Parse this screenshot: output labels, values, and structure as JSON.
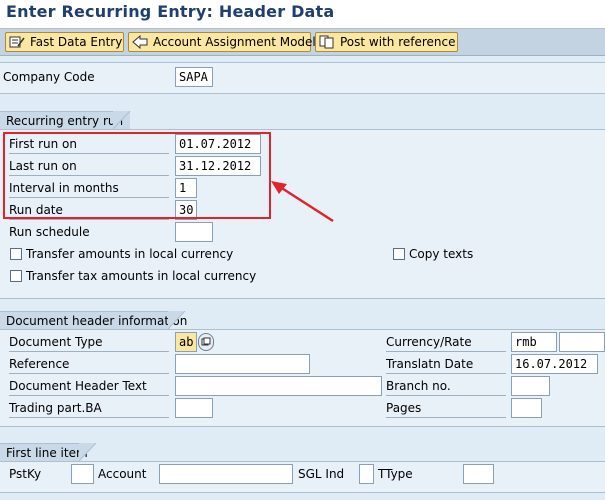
{
  "title": "Enter Recurring Entry: Header Data",
  "toolbar": {
    "fast_data_entry": "Fast Data Entry",
    "account_assignment_model": "Account Assignment Model",
    "post_with_reference": "Post with reference"
  },
  "company": {
    "label": "Company Code",
    "value": "SAPA"
  },
  "recurring": {
    "section_title": "Recurring entry run",
    "first_run_label": "First run on",
    "first_run_value": "01.07.2012",
    "last_run_label": "Last run on",
    "last_run_value": "31.12.2012",
    "interval_label": "Interval in months",
    "interval_value": "1",
    "run_date_label": "Run date",
    "run_date_value": "30",
    "run_schedule_label": "Run schedule",
    "run_schedule_value": "",
    "transfer_local_label": "Transfer amounts in local currency",
    "transfer_tax_label": "Transfer tax amounts in local currency",
    "copy_texts_label": "Copy texts"
  },
  "doc_header": {
    "section_title": "Document header information",
    "doc_type_label": "Document Type",
    "doc_type_value": "ab",
    "reference_label": "Reference",
    "reference_value": "",
    "header_text_label": "Document Header Text",
    "header_text_value": "",
    "trading_label": "Trading part.BA",
    "trading_value": "",
    "currency_label": "Currency/Rate",
    "currency_value": "rmb",
    "rate_value": "",
    "translation_label": "Translatn Date",
    "translation_value": "16.07.2012",
    "branch_label": "Branch no.",
    "branch_value": "",
    "pages_label": "Pages",
    "pages_value": ""
  },
  "first_line": {
    "section_title": "First line item",
    "pstky_label": "PstKy",
    "pstky_value": "",
    "account_label": "Account",
    "account_value": "",
    "sgl_label": "SGL Ind",
    "sgl_value": "",
    "ttype_label": "TType",
    "ttype_value": ""
  },
  "colors": {
    "highlight": "#e0242a",
    "button": "#fbe7a0",
    "title": "#1f3f6e"
  },
  "icons": [
    "fast-entry-icon",
    "account-model-icon",
    "post-reference-icon",
    "value-help-icon",
    "red-arrow-annotation"
  ]
}
